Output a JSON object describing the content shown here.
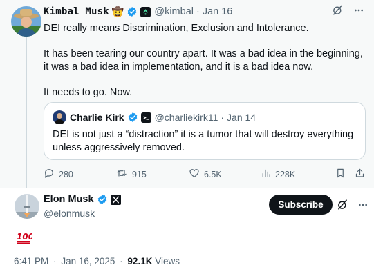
{
  "parent": {
    "author_name": "Kimbal Musk",
    "author_emoji": "🤠",
    "handle": "@kimbal",
    "separator": "·",
    "date": "Jan 16",
    "paragraphs": [
      "DEI really means Discrimination, Exclusion and Intolerance.",
      "It has been tearing our country apart. It was a bad idea in the beginning, it was a bad idea in implementation, and it is a bad idea now.",
      "It needs to go. Now."
    ],
    "quote": {
      "author_name": "Charlie Kirk",
      "handle": "@charliekirk11",
      "separator": "·",
      "date": "Jan 14",
      "text": "DEI is not just a “distraction” it is a tumor that will destroy everything unless aggressively removed."
    },
    "stats": {
      "replies": "280",
      "reposts": "915",
      "likes": "6.5K",
      "views": "228K"
    }
  },
  "main": {
    "author_name": "Elon Musk",
    "handle": "@elonmusk",
    "subscribe_label": "Subscribe",
    "text": "💯",
    "time": "6:41 PM",
    "separator": "·",
    "date": "Jan 16, 2025",
    "dot": "·",
    "view_count": "92.1K",
    "views_label": "Views"
  },
  "colors": {
    "verified_blue": "#1d9bf0",
    "muted_text": "#536471",
    "thread_background": "#f7f9f9",
    "hundred_red": "#d0021b"
  },
  "icons": [
    "cowboy-emoji",
    "verified-badge",
    "affiliate-badge",
    "grok-icon",
    "more-icon",
    "reply-icon",
    "repost-icon",
    "like-icon",
    "views-icon",
    "bookmark-icon",
    "share-icon",
    "x-logo-badge",
    "hundred-emoji"
  ]
}
